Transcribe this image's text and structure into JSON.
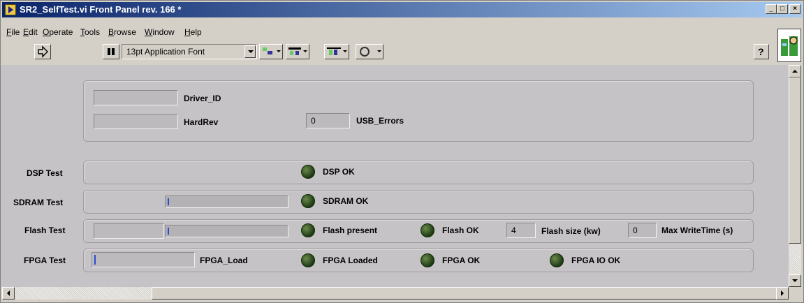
{
  "window": {
    "title": "SR2_SelfTest.vi Front Panel rev. 166 *"
  },
  "menu": [
    {
      "key": "F",
      "rest": "ile"
    },
    {
      "key": "E",
      "rest": "dit"
    },
    {
      "key": "O",
      "rest": "perate"
    },
    {
      "key": "T",
      "rest": "ools"
    },
    {
      "key": "B",
      "rest": "rowse"
    },
    {
      "key": "W",
      "rest": "indow"
    },
    {
      "key": "H",
      "rest": "elp"
    }
  ],
  "toolbar": {
    "font": "13pt Application Font"
  },
  "info": {
    "driver_id_label": "Driver_ID",
    "driver_id_value": "",
    "hardrev_label": "HardRev",
    "hardrev_value": "",
    "usb_errors_label": "USB_Errors",
    "usb_errors_value": "0"
  },
  "dsp": {
    "label": "DSP Test",
    "led_label": "DSP OK"
  },
  "sdram": {
    "label": "SDRAM Test",
    "led_label": "SDRAM OK",
    "progress": 0.01
  },
  "flash": {
    "label": "Flash Test",
    "progress": 0.01,
    "present_label": "Flash present",
    "ok_label": "Flash OK",
    "size_value": "4",
    "size_label": "Flash size (kw)",
    "writetime_value": "0",
    "writetime_label": "Max WriteTime (s)"
  },
  "fpga": {
    "label": "FPGA Test",
    "load_label": "FPGA_Load",
    "loaded_label": "FPGA Loaded",
    "ok_label": "FPGA OK",
    "io_ok_label": "FPGA IO OK"
  },
  "colors": {
    "title_start": "#0a246a",
    "title_end": "#a6caf0",
    "led_off": "#1e3a14",
    "panel": "#c6c3c6"
  }
}
